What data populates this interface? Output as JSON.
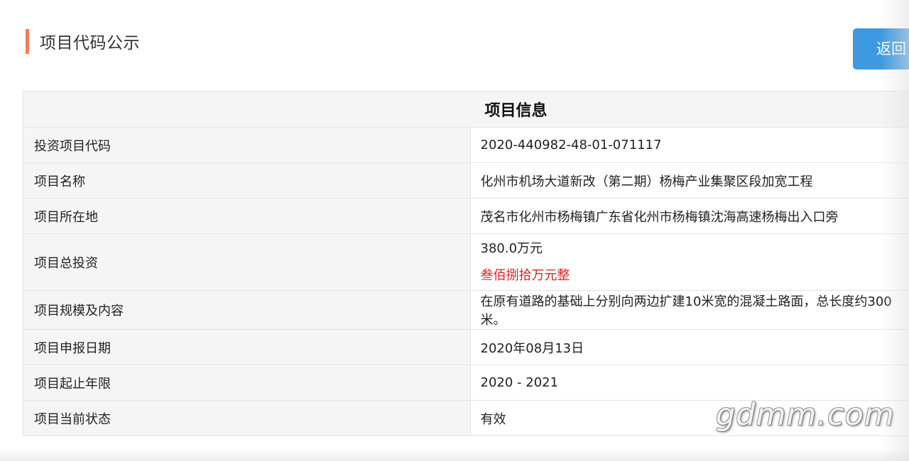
{
  "heading": {
    "title": "项目代码公示"
  },
  "back_button": {
    "label": "返回"
  },
  "table": {
    "title": "项目信息",
    "rows": [
      {
        "label": "投资项目代码",
        "value": "2020-440982-48-01-071117"
      },
      {
        "label": "项目名称",
        "value": "化州市机场大道新改（第二期）杨梅产业集聚区段加宽工程"
      },
      {
        "label": "项目所在地",
        "value": "茂名市化州市杨梅镇广东省化州市杨梅镇沈海高速杨梅出入口旁"
      },
      {
        "label": "项目总投资",
        "value": "380.0万元",
        "value_cn": "叁佰捌拾万元整"
      },
      {
        "label": "项目规模及内容",
        "value": "在原有道路的基础上分别向两边扩建10米宽的混凝土路面，总长度约300米。"
      },
      {
        "label": "项目申报日期",
        "value": "2020年08月13日"
      },
      {
        "label": "项目起止年限",
        "value": "2020 - 2021"
      },
      {
        "label": "项目当前状态",
        "value": "有效"
      }
    ]
  },
  "watermark": {
    "text": "gdmm.com"
  },
  "colors": {
    "accent_bar": "#f07f5c",
    "button_bg": "#3d9ae0",
    "amount_red": "#e02020",
    "label_bg": "#f5f5f5"
  }
}
